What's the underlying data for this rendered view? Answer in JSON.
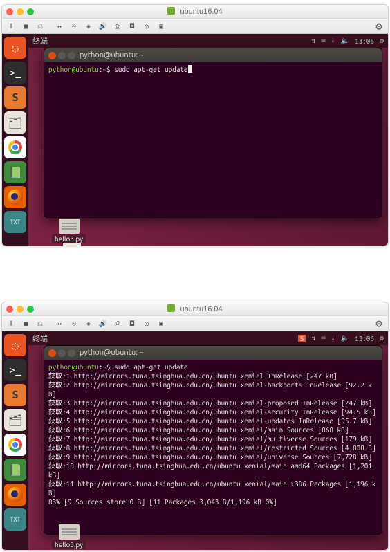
{
  "vm": {
    "name_label": "ubuntu16.04",
    "toolbar_icons": [
      "pause",
      "stop",
      "snapshot",
      "fullscreen",
      "arrows",
      "usb-icon",
      "sound-icon",
      "clipboard-icon",
      "disk-icon",
      "disk2-icon"
    ],
    "toolbar_right_icon": "gear-icon"
  },
  "top": {
    "menubar": {
      "app_label": "终端",
      "status": {
        "network": "net-icon",
        "vol": "vol-icon",
        "clock": "13:06",
        "gear": "gear-icon"
      }
    },
    "terminal": {
      "title": "python@ubuntu: ~",
      "prompt_user": "python@ubuntu",
      "prompt_path": "~",
      "prompt_symbol": "$",
      "command": "sudo apt-get update"
    },
    "desktop_file": "hello3.py"
  },
  "bottom": {
    "menubar": {
      "app_label": "终端",
      "status": {
        "ime": "S",
        "network": "net-icon",
        "vol": "vol-icon",
        "clock": "13:06",
        "gear": "gear-icon"
      }
    },
    "terminal": {
      "title": "python@ubuntu: ~",
      "prompt_user": "python@ubuntu",
      "prompt_path": "~",
      "prompt_symbol": "$",
      "command": "sudo apt-get update",
      "output": [
        "获取:1 http://mirrors.tuna.tsinghua.edu.cn/ubuntu xenial InRelease [247 kB]",
        "获取:2 http://mirrors.tuna.tsinghua.edu.cn/ubuntu xenial-backports InRelease [92.2 kB]",
        "获取:3 http://mirrors.tuna.tsinghua.edu.cn/ubuntu xenial-proposed InRelease [247 kB]",
        "获取:4 http://mirrors.tuna.tsinghua.edu.cn/ubuntu xenial-security InRelease [94.5 kB]",
        "获取:5 http://mirrors.tuna.tsinghua.edu.cn/ubuntu xenial-updates InRelease [95.7 kB]",
        "获取:6 http://mirrors.tuna.tsinghua.edu.cn/ubuntu xenial/main Sources [868 kB]",
        "获取:7 http://mirrors.tuna.tsinghua.edu.cn/ubuntu xenial/multiverse Sources [179 kB]",
        "获取:8 http://mirrors.tuna.tsinghua.edu.cn/ubuntu xenial/restricted Sources [4,808 B]",
        "获取:9 http://mirrors.tuna.tsinghua.edu.cn/ubuntu xenial/universe Sources [7,728 kB]",
        "获取:10 http://mirrors.tuna.tsinghua.edu.cn/ubuntu xenial/main amd64 Packages [1,201 kB]",
        "获取:11 http://mirrors.tuna.tsinghua.edu.cn/ubuntu xenial/main i386 Packages [1,196 kB]",
        "83% [9 Sources store 0 B] [11 Packages 3,043 B/1,196 kB 0%]"
      ]
    },
    "desktop_file": "hello3.py"
  },
  "launcher_items": [
    {
      "name": "ubuntu-dash",
      "cls": "li-ubuntu",
      "glyph": "◌"
    },
    {
      "name": "terminal-app",
      "cls": "li-terminal",
      "glyph": ">_"
    },
    {
      "name": "sublime-app",
      "cls": "li-sublime",
      "glyph": "S"
    },
    {
      "name": "files-app",
      "cls": "li-files",
      "glyph": "🗂"
    },
    {
      "name": "chrome-app",
      "cls": "li-chrome",
      "glyph": ""
    },
    {
      "name": "office-app",
      "cls": "li-office",
      "glyph": "📗"
    },
    {
      "name": "firefox-app",
      "cls": "li-firefox",
      "glyph": ""
    },
    {
      "name": "texteditor-app",
      "cls": "li-text",
      "glyph": "TXT"
    }
  ]
}
